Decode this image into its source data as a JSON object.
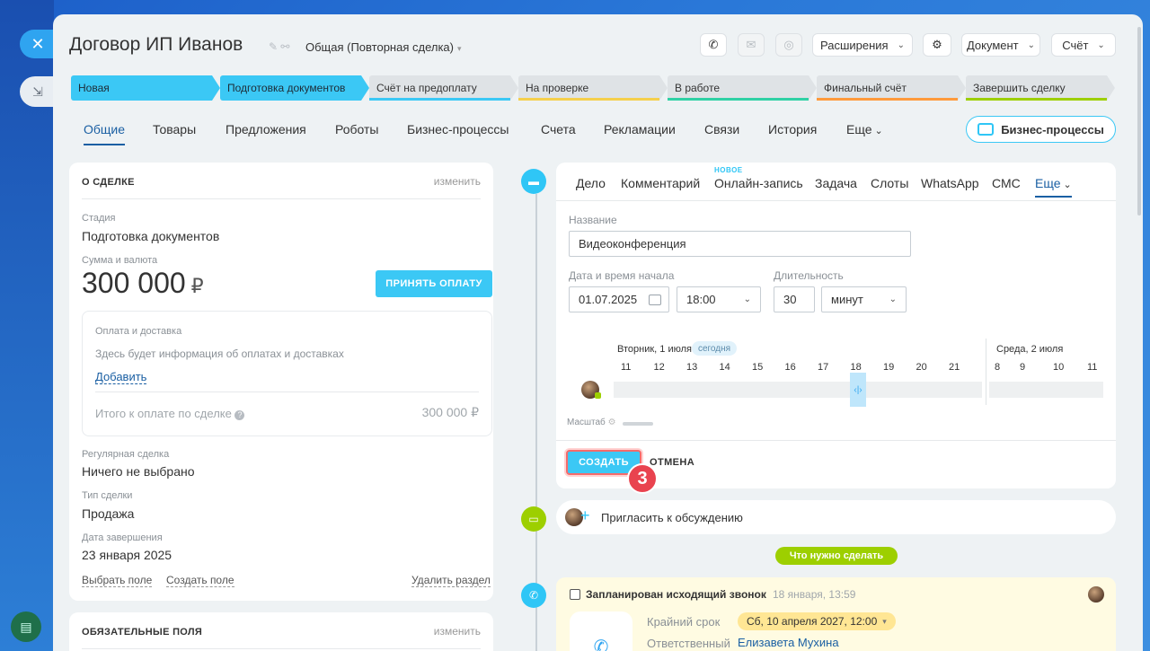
{
  "window": {
    "close_icon": "close-icon",
    "side_icon": "collapse-arrow-icon",
    "bottom_icon": "printer-icon"
  },
  "header": {
    "title": "Договор ИП Иванов",
    "category": "Общая (Повторная сделка)",
    "buttons": {
      "extensions": "Расширения",
      "document": "Документ",
      "invoice": "Счёт"
    }
  },
  "stages": [
    {
      "label": "Новая",
      "active": true,
      "color": "#3bc8f5"
    },
    {
      "label": "Подготовка документов",
      "active": true,
      "color": "#3bc8f5"
    },
    {
      "label": "Счёт на предоплату",
      "active": false,
      "color": "#3bc8f5"
    },
    {
      "label": "На проверке",
      "active": false,
      "color": "#f5d04c"
    },
    {
      "label": "В работе",
      "active": false,
      "color": "#2fd1a5"
    },
    {
      "label": "Финальный счёт",
      "active": false,
      "color": "#ff9a3c"
    },
    {
      "label": "Завершить сделку",
      "active": false,
      "color": "#9dcf00"
    }
  ],
  "tabs": [
    "Общие",
    "Товары",
    "Предложения",
    "Роботы",
    "Бизнес-процессы",
    "Счета",
    "Рекламации",
    "Связи",
    "История",
    "Еще"
  ],
  "bp_button": "Бизнес-процессы",
  "deal": {
    "section_title": "О СДЕЛКЕ",
    "edit": "изменить",
    "stage_label": "Стадия",
    "stage_value": "Подготовка документов",
    "sum_label": "Сумма и валюта",
    "sum_value": "300 000",
    "currency": "₽",
    "pay_button": "ПРИНЯТЬ ОПЛАТУ",
    "payment_title": "Оплата и доставка",
    "payment_info": "Здесь будет информация об оплатах и доставках",
    "payment_add": "Добавить",
    "total_label": "Итого к оплате по сделке",
    "total_value": "300 000 ₽",
    "regular_label": "Регулярная сделка",
    "regular_value": "Ничего не выбрано",
    "type_label": "Тип сделки",
    "type_value": "Продажа",
    "close_label": "Дата завершения",
    "close_value": "23 января 2025",
    "choose_field": "Выбрать поле",
    "create_field": "Создать поле",
    "delete_section": "Удалить раздел"
  },
  "required": {
    "section_title": "ОБЯЗАТЕЛЬНЫЕ ПОЛЯ",
    "edit": "изменить"
  },
  "editor": {
    "tabs": [
      "Дело",
      "Комментарий",
      "Онлайн-запись",
      "Задача",
      "Слоты",
      "WhatsApp",
      "СМС",
      "Еще"
    ],
    "new_badge": "НОВОЕ",
    "name_label": "Название",
    "name_value": "Видеоконференция",
    "start_label": "Дата и время начала",
    "date_value": "01.07.2025",
    "time_value": "18:00",
    "duration_label": "Длительность",
    "duration_value": "30",
    "unit_value": "минут",
    "day1": "Вторник, 1 июля",
    "today": "сегодня",
    "day2": "Среда, 2 июля",
    "hours1": [
      "11",
      "12",
      "13",
      "14",
      "15",
      "16",
      "17",
      "18",
      "19",
      "20",
      "21"
    ],
    "hours2": [
      "8",
      "9",
      "10",
      "11"
    ],
    "scale_label": "Масштаб",
    "create": "СОЗДАТЬ",
    "cancel": "ОТМЕНА",
    "step_number": "3"
  },
  "timeline": {
    "invite": "Пригласить к обсуждению",
    "todo_pill": "Что нужно сделать",
    "call_title": "Запланирован исходящий звонок",
    "call_time": "18 января, 13:59",
    "deadline_label": "Крайний срок",
    "deadline_value": "Сб, 10 апреля 2027, 12:00",
    "responsible_label": "Ответственный",
    "responsible_value": "Елизавета Мухина"
  }
}
